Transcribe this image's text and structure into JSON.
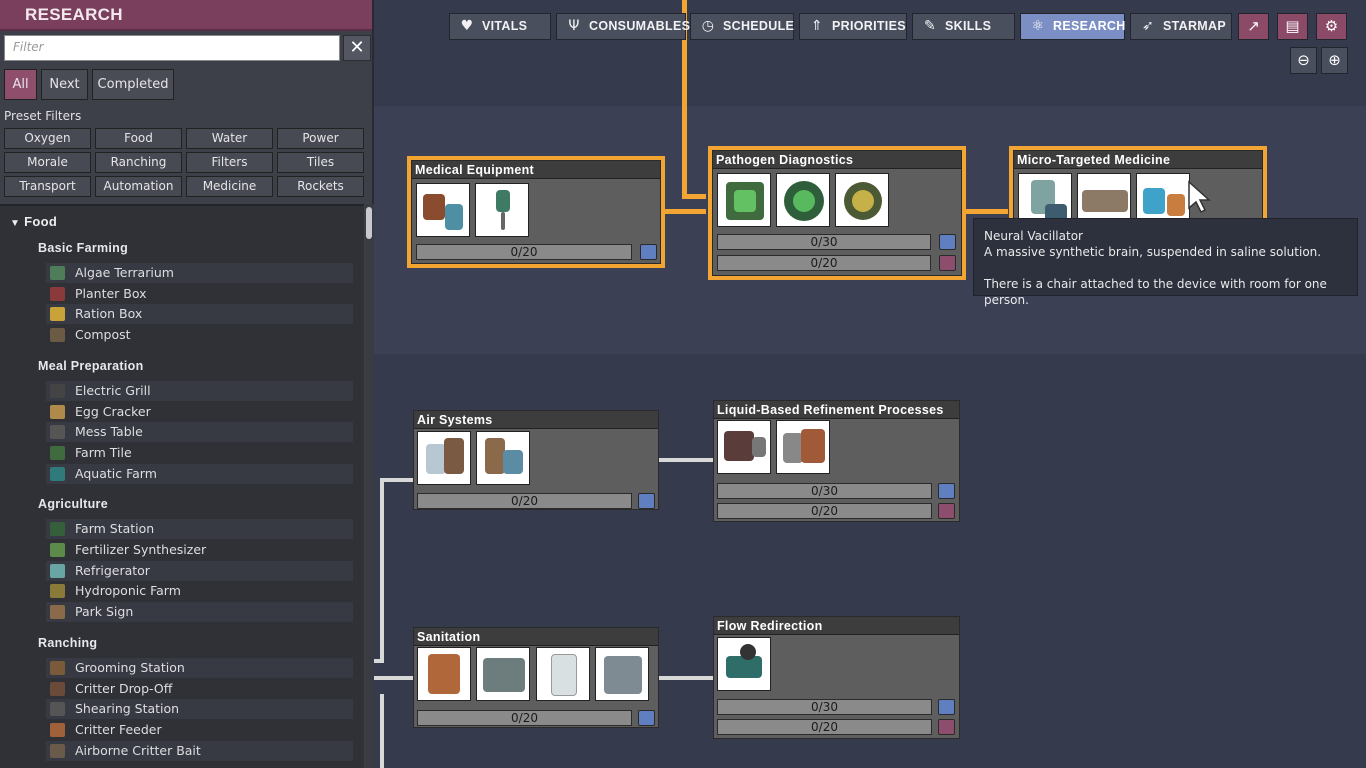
{
  "sidebar": {
    "title": "RESEARCH",
    "filter_placeholder": "Filter",
    "tabs": [
      "All",
      "Next",
      "Completed"
    ],
    "preset_label": "Preset Filters",
    "presets": [
      "Oxygen",
      "Food",
      "Water",
      "Power",
      "Morale",
      "Ranching",
      "Filters",
      "Tiles",
      "Transport",
      "Automation",
      "Medicine",
      "Rockets"
    ],
    "tree": {
      "category": "Food",
      "groups": [
        {
          "name": "Basic Farming",
          "items": [
            "Algae Terrarium",
            "Planter Box",
            "Ration Box",
            "Compost"
          ]
        },
        {
          "name": "Meal Preparation",
          "items": [
            "Electric Grill",
            "Egg Cracker",
            "Mess Table",
            "Farm Tile",
            "Aquatic Farm"
          ]
        },
        {
          "name": "Agriculture",
          "items": [
            "Farm Station",
            "Fertilizer Synthesizer",
            "Refrigerator",
            "Hydroponic Farm",
            "Park Sign"
          ]
        },
        {
          "name": "Ranching",
          "items": [
            "Grooming Station",
            "Critter Drop-Off",
            "Shearing Station",
            "Critter Feeder",
            "Airborne Critter Bait"
          ]
        }
      ]
    }
  },
  "nav": {
    "tabs": [
      {
        "label": "VITALS",
        "icon": "heart-icon"
      },
      {
        "label": "CONSUMABLES",
        "icon": "utensils-icon"
      },
      {
        "label": "SCHEDULE",
        "icon": "clock-icon"
      },
      {
        "label": "PRIORITIES",
        "icon": "priorities-icon"
      },
      {
        "label": "SKILLS",
        "icon": "wrench-icon"
      },
      {
        "label": "RESEARCH",
        "icon": "atom-icon"
      },
      {
        "label": "STARMAP",
        "icon": "rocket-icon"
      }
    ],
    "active": "RESEARCH",
    "extra_icons": [
      "report-chart-icon",
      "codex-book-icon",
      "settings-gear-icon"
    ],
    "zoom_icons": [
      "zoom-out-icon",
      "zoom-in-icon"
    ]
  },
  "techs": [
    {
      "id": "medical-equipment",
      "title": "Medical Equipment",
      "progress": [
        "0/20"
      ],
      "highlighted": true
    },
    {
      "id": "pathogen-diagnostics",
      "title": "Pathogen Diagnostics",
      "progress": [
        "0/30",
        "0/20"
      ],
      "highlighted": true
    },
    {
      "id": "micro-targeted-medicine",
      "title": "Micro-Targeted Medicine",
      "progress": [],
      "highlighted": true
    },
    {
      "id": "air-systems",
      "title": "Air Systems",
      "progress": [
        "0/20"
      ]
    },
    {
      "id": "liquid-refinement",
      "title": "Liquid-Based Refinement Processes",
      "progress": [
        "0/30",
        "0/20"
      ]
    },
    {
      "id": "sanitation",
      "title": "Sanitation",
      "progress": [
        "0/20"
      ]
    },
    {
      "id": "flow-redirection",
      "title": "Flow Redirection",
      "progress": [
        "0/30",
        "0/20"
      ]
    }
  ],
  "tooltip": {
    "title": "Neural Vacillator",
    "line1": "A massive synthetic brain, suspended in saline solution.",
    "line2": "There is a chair attached to the device with room for one person."
  },
  "colors": {
    "highlight": "#f3a534",
    "active_tab": "#7c8fc4",
    "sidebar_header": "#7a3f5c"
  }
}
